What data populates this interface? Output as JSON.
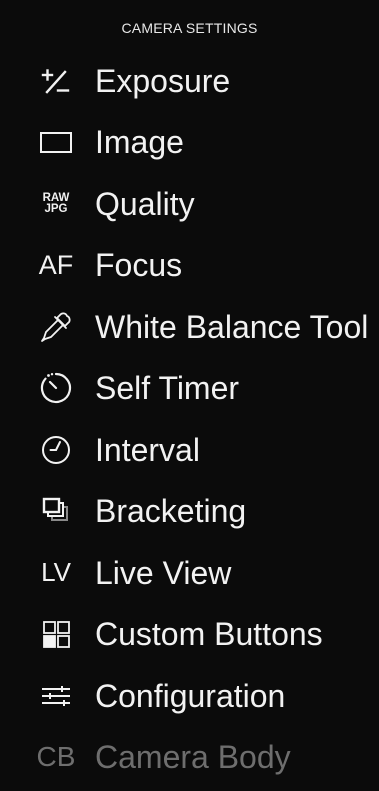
{
  "header": {
    "title": "CAMERA SETTINGS"
  },
  "menu": {
    "items": [
      {
        "label": "Exposure",
        "icon": "exposure-plus-minus-icon"
      },
      {
        "label": "Image",
        "icon": "image-rectangle-icon"
      },
      {
        "label": "Quality",
        "icon": "raw-jpg-icon",
        "icon_text_top": "RAW",
        "icon_text_bottom": "JPG"
      },
      {
        "label": "Focus",
        "icon": "af-icon",
        "icon_text": "AF"
      },
      {
        "label": "White Balance Tool",
        "icon": "eyedropper-icon"
      },
      {
        "label": "Self Timer",
        "icon": "self-timer-icon"
      },
      {
        "label": "Interval",
        "icon": "clock-icon"
      },
      {
        "label": "Bracketing",
        "icon": "bracketing-icon"
      },
      {
        "label": "Live View",
        "icon": "lv-icon",
        "icon_text": "LV"
      },
      {
        "label": "Custom Buttons",
        "icon": "custom-buttons-grid-icon"
      },
      {
        "label": "Configuration",
        "icon": "configuration-sliders-icon"
      },
      {
        "label": "Camera Body",
        "icon": "cb-icon",
        "icon_text": "CB",
        "disabled": true
      }
    ]
  },
  "colors": {
    "background": "#0b0b0b",
    "text": "#f2f2f2",
    "disabled_text": "#6e6e6e"
  }
}
